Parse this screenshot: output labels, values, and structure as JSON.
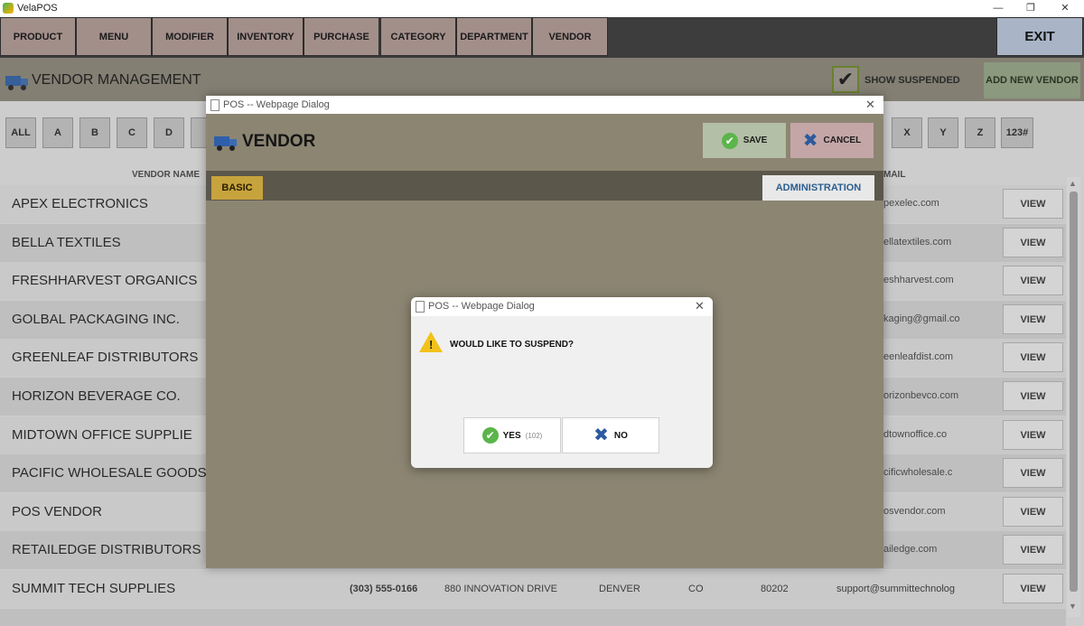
{
  "window": {
    "title": "VelaPOS",
    "minimize": "—",
    "restore": "❐",
    "close": "✕"
  },
  "nav": {
    "items": [
      "PRODUCT",
      "MENU",
      "MODIFIER",
      "INVENTORY",
      "PURCHASE",
      "CATEGORY",
      "DEPARTMENT",
      "VENDOR"
    ],
    "exit": "EXIT"
  },
  "header": {
    "title": "VENDOR MANAGEMENT",
    "show_suspended": {
      "label": "SHOW SUSPENDED",
      "checked": true,
      "mark": "✔"
    },
    "add_new": "ADD NEW VENDOR"
  },
  "alpha_left": [
    "ALL",
    "A",
    "B",
    "C",
    "D"
  ],
  "alpha_right": [
    "X",
    "Y",
    "Z",
    "123#"
  ],
  "table": {
    "col_vendor": "VENDOR NAME",
    "col_email": "MAIL",
    "view_label": "VIEW",
    "rows": [
      {
        "name": "APEX ELECTRONICS",
        "email": "pexelec.com"
      },
      {
        "name": "BELLA TEXTILES",
        "email": "ellatextiles.com"
      },
      {
        "name": "FRESHHARVEST ORGANICS",
        "email": "eshharvest.com"
      },
      {
        "name": "GOLBAL PACKAGING INC.",
        "email": "kaging@gmail.co"
      },
      {
        "name": "GREENLEAF DISTRIBUTORS",
        "email": "eenleafdist.com"
      },
      {
        "name": "HORIZON BEVERAGE CO.",
        "email": "orizonbevco.com"
      },
      {
        "name": "MIDTOWN OFFICE SUPPLIE",
        "email": "dtownoffice.co"
      },
      {
        "name": "PACIFIC WHOLESALE GOODS",
        "email": "cificwholesale.c"
      },
      {
        "name": "POS VENDOR",
        "email": "osvendor.com"
      },
      {
        "name": "RETAILEDGE DISTRIBUTORS",
        "email": "ailedge.com"
      },
      {
        "name": "SUMMIT TECH SUPPLIES",
        "email": "support@summittechnolog",
        "phone": "(303) 555-0166",
        "address": "880 INNOVATION DRIVE",
        "city": "DENVER",
        "state": "CO",
        "zip": "80202"
      }
    ]
  },
  "vendor_dialog": {
    "title": "POS -- Webpage Dialog",
    "close": "✕",
    "heading": "VENDOR",
    "save": "SAVE",
    "cancel": "CANCEL",
    "tab_basic": "BASIC",
    "tab_admin": "ADMINISTRATION"
  },
  "confirm_dialog": {
    "title": "POS -- Webpage Dialog",
    "close": "✕",
    "message": "WOULD LIKE TO SUSPEND?",
    "warn_mark": "!",
    "yes": "YES",
    "yes_count": "(102)",
    "no": "NO"
  },
  "icons": {
    "check": "✔",
    "x": "✖"
  }
}
